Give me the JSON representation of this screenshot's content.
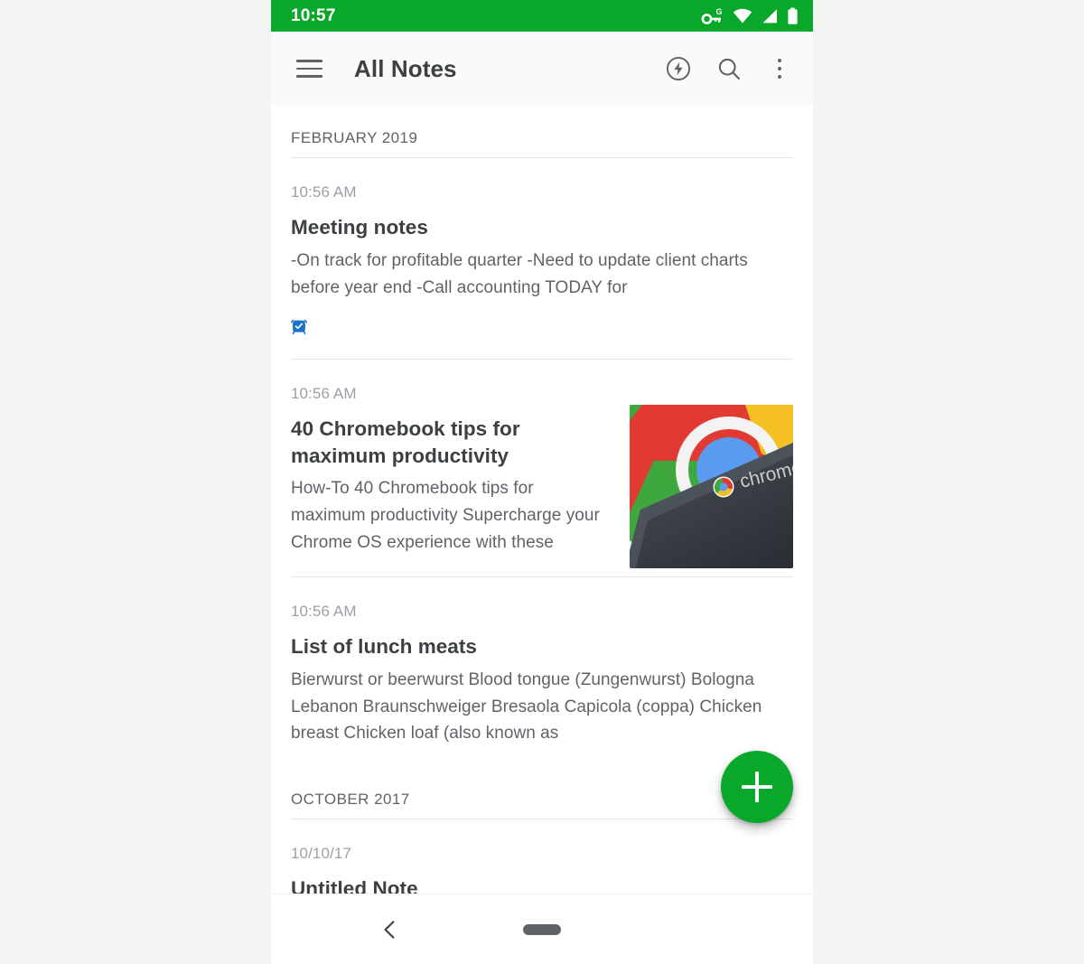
{
  "status_bar": {
    "time": "10:57",
    "icons": [
      "vpn-key-icon",
      "wifi-icon",
      "cellular-signal-icon",
      "battery-icon"
    ]
  },
  "toolbar": {
    "menu_icon": "hamburger-menu-icon",
    "title": "All Notes",
    "actions": [
      {
        "name": "sync-flash-icon",
        "label": "Sync"
      },
      {
        "name": "search-icon",
        "label": "Search"
      },
      {
        "name": "overflow-menu-icon",
        "label": "More options"
      }
    ]
  },
  "sections": [
    {
      "header": "FEBRUARY 2019",
      "notes": [
        {
          "time": "10:56 AM",
          "title": "Meeting notes",
          "snippet": "-On track for profitable quarter -Need to update client charts before year end -Call accounting TODAY for",
          "reminder": true,
          "reminder_icon": "alarm-clock-icon",
          "thumbnail": null
        },
        {
          "time": "10:56 AM",
          "title": "40 Chromebook tips for maximum productivity",
          "snippet": "How-To 40 Chromebook tips for maximum productivity    Supercharge your Chrome OS experience with these",
          "reminder": false,
          "thumbnail": {
            "name": "chromebook-thumbnail",
            "alt_text": "chrome",
            "colors": {
              "red": "#E03A33",
              "green": "#3EA83E",
              "yellow": "#F5C024",
              "blue": "#5A9BF0",
              "device": "#3b4046"
            }
          }
        },
        {
          "time": "10:56 AM",
          "title": "List of lunch meats",
          "snippet": "Bierwurst or beerwurst Blood tongue (Zungenwurst) Bologna Lebanon Braunschweiger Bresaola Capicola (coppa) Chicken breast Chicken loaf (also known as",
          "reminder": false,
          "thumbnail": null
        }
      ]
    },
    {
      "header": "OCTOBER 2017",
      "notes": [
        {
          "time": "10/10/17",
          "title": "Untitled Note",
          "snippet": "",
          "reminder": false,
          "thumbnail": null
        }
      ]
    }
  ],
  "fab": {
    "name": "add-note-fab",
    "label": "+",
    "color": "#0AA82A"
  },
  "navigation_bar": {
    "back_label": "Back",
    "home_label": "Home"
  },
  "theme": {
    "accent": "#0AA82A",
    "toolbar_bg": "#FAFAFA",
    "divider": "#E4E4E4",
    "title_text": "#3C4043",
    "secondary_text": "#5F6368",
    "muted_text": "#9AA0A6"
  }
}
